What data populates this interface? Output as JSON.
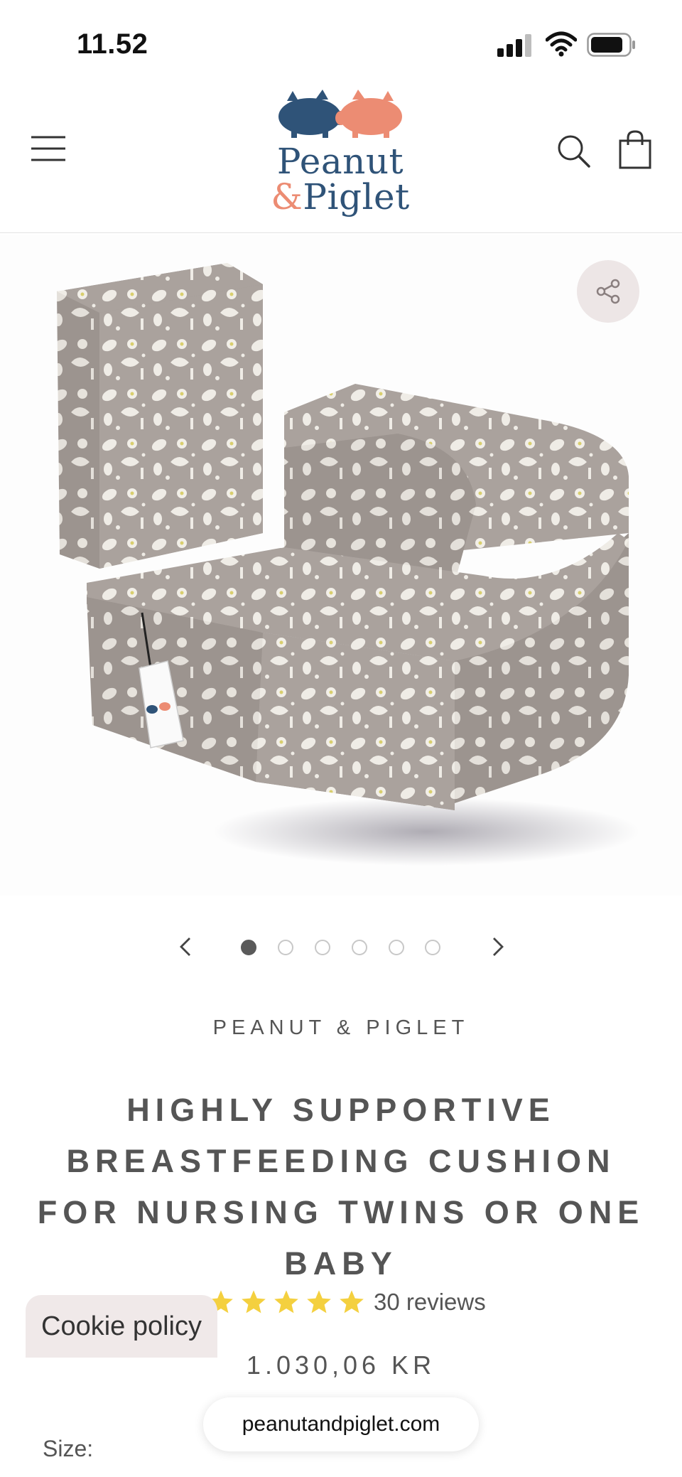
{
  "status_bar": {
    "time": "11.52"
  },
  "header": {
    "logo": {
      "line1": "Peanut",
      "line2_amp": "&",
      "line2_word": "Piglet"
    }
  },
  "gallery": {
    "slides_total": 6,
    "active_slide": 1
  },
  "product": {
    "vendor": "PEANUT & PIGLET",
    "title": "HIGHLY SUPPORTIVE BREASTFEEDING CUSHION FOR NURSING TWINS OR ONE BABY",
    "rating_stars": 5,
    "reviews_label": "30 reviews",
    "price": "1.030,06 KR",
    "size_label": "Size:"
  },
  "overlays": {
    "cookie_policy": "Cookie policy",
    "url": "peanutandpiglet.com"
  },
  "colors": {
    "logo_blue": "#2f5378",
    "logo_coral": "#ec8c73",
    "star_yellow": "#f4d03f",
    "cushion_gray": "#a9a19c",
    "share_bg": "#ede6e6"
  },
  "icons": [
    "hamburger-menu-icon",
    "search-icon",
    "shopping-bag-icon",
    "share-icon",
    "chevron-left-icon",
    "chevron-right-icon",
    "star-icon"
  ]
}
